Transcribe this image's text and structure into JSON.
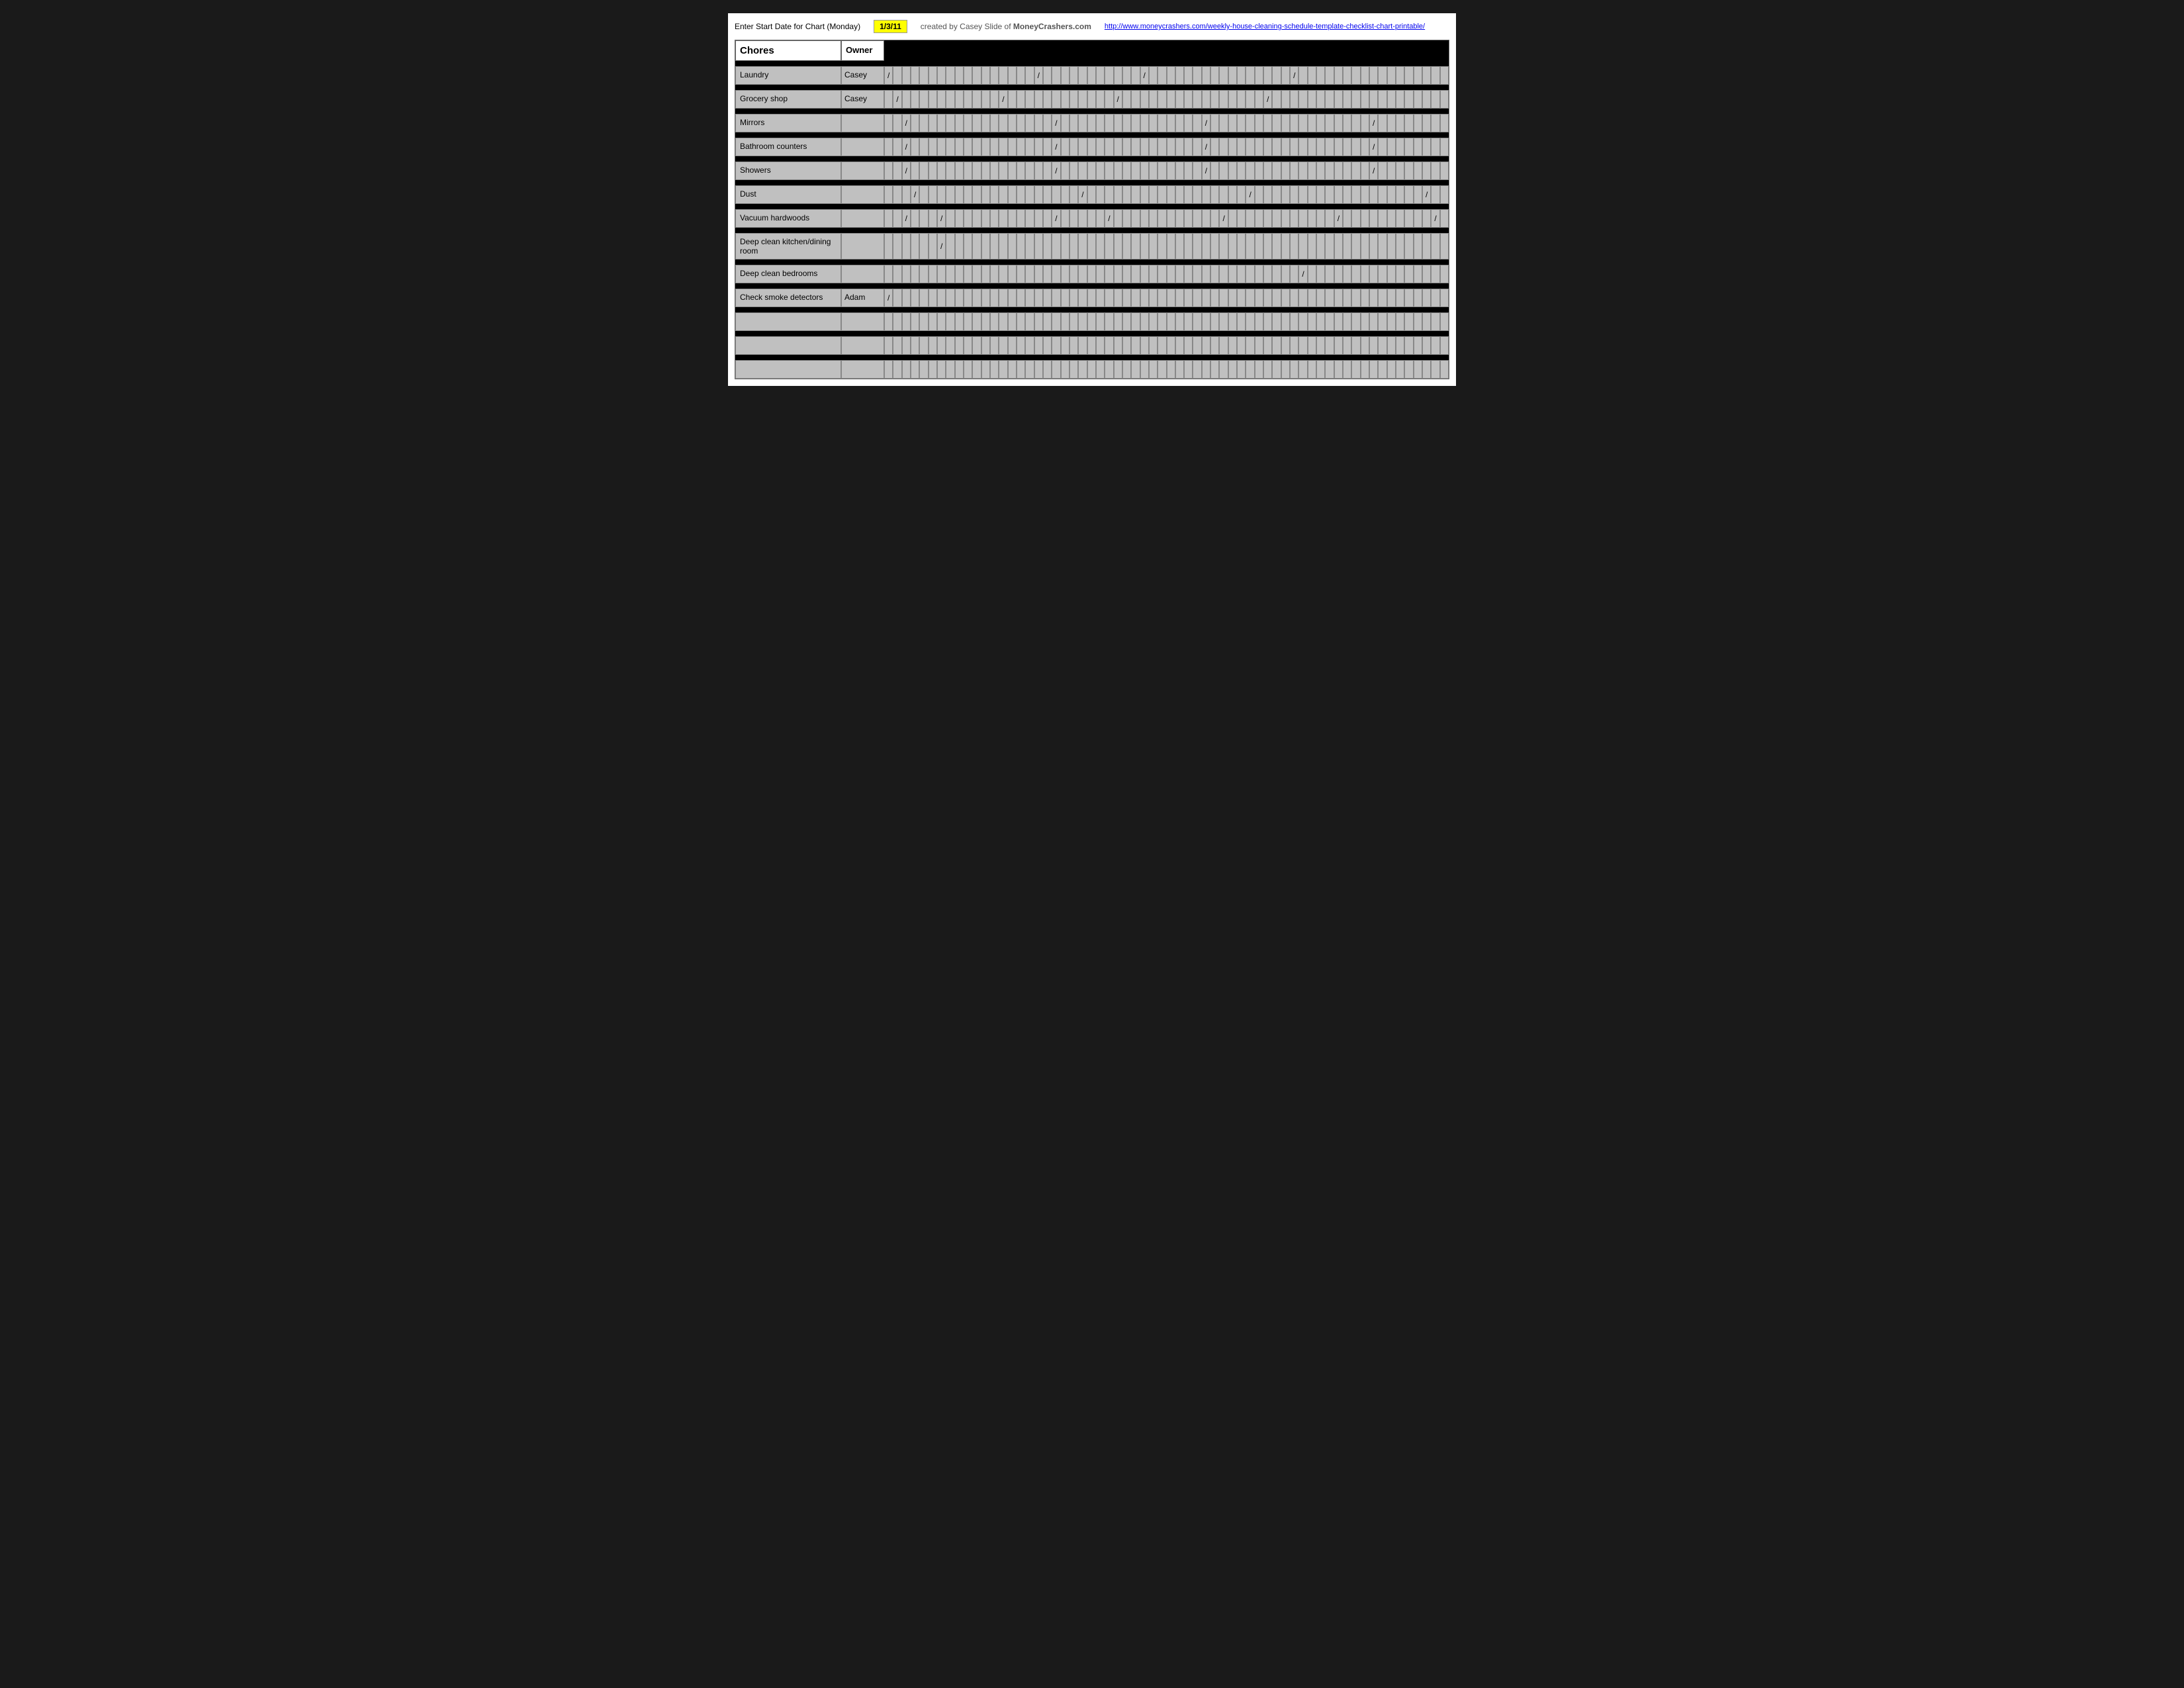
{
  "topbar": {
    "start_date_label": "Enter Start Date for Chart (Monday)",
    "start_date_value": "1/3/11",
    "created_by_prefix": "created by Casey Slide of ",
    "created_by_site": "MoneyCrashers.com",
    "link_url": "http://www.moneycrashers.com/weekly-house-cleaning-schedule-template-checklist-chart-printable/",
    "link_text": "http://www.moneycrashers.com/weekly-house-cleaning-schedule-template-checklist-chart-printable/"
  },
  "header": {
    "chores_label": "Chores",
    "owner_label": "Owner"
  },
  "rows": [
    {
      "chore": "Laundry",
      "owner": "Casey",
      "marks": [
        "/",
        "",
        "",
        "",
        "",
        "",
        "",
        "",
        "",
        "",
        "",
        "",
        "",
        "",
        "",
        "",
        "",
        "/",
        "",
        "",
        "",
        "",
        "",
        "",
        "",
        "",
        "",
        "",
        "",
        "/",
        "",
        "",
        "",
        "",
        "",
        "",
        "",
        "",
        "",
        "",
        "",
        "",
        "",
        "",
        "",
        "",
        "/",
        "",
        "",
        "",
        "",
        "",
        "",
        "",
        "",
        "",
        "",
        "",
        "",
        "",
        "",
        "",
        "",
        "",
        ""
      ]
    },
    {
      "chore": "Grocery shop",
      "owner": "Casey",
      "marks": [
        "",
        "/",
        "",
        "",
        "",
        "",
        "",
        "",
        "",
        "",
        "",
        "",
        "",
        "/",
        "",
        "",
        "",
        "",
        "",
        "",
        "",
        "",
        "",
        "",
        "",
        "",
        "/",
        "",
        "",
        "",
        "",
        "",
        "",
        "",
        "",
        "",
        "",
        "",
        "",
        "",
        "",
        "",
        "",
        "/",
        "",
        "",
        "",
        "",
        "",
        "",
        "",
        "",
        "",
        "",
        "",
        "",
        "",
        "",
        "",
        "",
        "",
        "",
        ""
      ]
    },
    {
      "chore": "Mirrors",
      "owner": "",
      "marks": [
        "",
        "",
        "/",
        "",
        "",
        "",
        "",
        "",
        "",
        "",
        "",
        "",
        "",
        "",
        "",
        "",
        "",
        "",
        "",
        "/",
        "",
        "",
        "",
        "",
        "",
        "",
        "",
        "",
        "",
        "",
        "",
        "",
        "",
        "",
        "",
        "",
        "/",
        "",
        "",
        "",
        "",
        "",
        "",
        "",
        "",
        "",
        "",
        "",
        "",
        "",
        "",
        "",
        "",
        "",
        "",
        "/",
        "",
        "",
        "",
        "",
        "",
        "",
        "",
        ""
      ]
    },
    {
      "chore": "Bathroom counters",
      "owner": "",
      "marks": [
        "",
        "",
        "/",
        "",
        "",
        "",
        "",
        "",
        "",
        "",
        "",
        "",
        "",
        "",
        "",
        "",
        "",
        "",
        "",
        "/",
        "",
        "",
        "",
        "",
        "",
        "",
        "",
        "",
        "",
        "",
        "",
        "",
        "",
        "",
        "",
        "",
        "/",
        "",
        "",
        "",
        "",
        "",
        "",
        "",
        "",
        "",
        "",
        "",
        "",
        "",
        "",
        "",
        "",
        "",
        "",
        "/",
        "",
        "",
        "",
        "",
        "",
        "",
        "",
        ""
      ]
    },
    {
      "chore": "Showers",
      "owner": "",
      "marks": [
        "",
        "",
        "/",
        "",
        "",
        "",
        "",
        "",
        "",
        "",
        "",
        "",
        "",
        "",
        "",
        "",
        "",
        "",
        "",
        "/",
        "",
        "",
        "",
        "",
        "",
        "",
        "",
        "",
        "",
        "",
        "",
        "",
        "",
        "",
        "",
        "",
        "/",
        "",
        "",
        "",
        "",
        "",
        "",
        "",
        "",
        "",
        "",
        "",
        "",
        "",
        "",
        "",
        "",
        "",
        "",
        "/",
        "",
        "",
        "",
        "",
        "",
        "",
        "",
        ""
      ]
    },
    {
      "chore": "Dust",
      "owner": "",
      "marks": [
        "",
        "",
        "",
        "/",
        "",
        "",
        "",
        "",
        "",
        "",
        "",
        "",
        "",
        "",
        "",
        "",
        "",
        "",
        "",
        "",
        "",
        "",
        "/",
        "",
        "",
        "",
        "",
        "",
        "",
        "",
        "",
        "",
        "",
        "",
        "",
        "",
        "",
        "",
        "",
        "",
        "",
        "/",
        "",
        "",
        "",
        "",
        "",
        "",
        "",
        "",
        "",
        "",
        "",
        "",
        "",
        "",
        "",
        "",
        "",
        "",
        "",
        "/",
        "",
        ""
      ]
    },
    {
      "chore": "Vacuum hardwoods",
      "owner": "",
      "marks": [
        "",
        "",
        "/",
        "",
        "",
        "",
        "/",
        "",
        "",
        "",
        "",
        "",
        "",
        "",
        "",
        "",
        "",
        "",
        "",
        "/",
        "",
        "",
        "",
        "",
        "",
        "/",
        "",
        "",
        "",
        "",
        "",
        "",
        "",
        "",
        "",
        "",
        "",
        "",
        "/",
        "",
        "",
        "",
        "",
        "",
        "",
        "",
        "",
        "",
        "",
        "",
        "",
        "/",
        "",
        "",
        "",
        "",
        "",
        "",
        "",
        "",
        "",
        "",
        "/"
      ]
    },
    {
      "chore": "Deep clean kitchen/dining room",
      "owner": "",
      "marks": [
        "",
        "",
        "",
        "",
        "",
        "",
        "/",
        "",
        "",
        "",
        "",
        "",
        "",
        "",
        "",
        "",
        "",
        "",
        "",
        "",
        "",
        "",
        "",
        "",
        "",
        "",
        "",
        "",
        "",
        "",
        "",
        "",
        "",
        "",
        "",
        "",
        "",
        "",
        "",
        "",
        "",
        "",
        "",
        "",
        "",
        "",
        "",
        "",
        "",
        "",
        "",
        "",
        "",
        "",
        "",
        "",
        "",
        "",
        "",
        "",
        "",
        "",
        "",
        ""
      ]
    },
    {
      "chore": "Deep clean bedrooms",
      "owner": "",
      "marks": [
        "",
        "",
        "",
        "",
        "",
        "",
        "",
        "",
        "",
        "",
        "",
        "",
        "",
        "",
        "",
        "",
        "",
        "",
        "",
        "",
        "",
        "",
        "",
        "",
        "",
        "",
        "",
        "",
        "",
        "",
        "",
        "",
        "",
        "",
        "",
        "",
        "",
        "",
        "",
        "",
        "",
        "",
        "",
        "",
        "",
        "",
        "",
        "/",
        "",
        "",
        "",
        "",
        "",
        "",
        "",
        "",
        "",
        "",
        "",
        "",
        "",
        "",
        "",
        "",
        ""
      ]
    },
    {
      "chore": "Check smoke detectors",
      "owner": "Adam",
      "marks": [
        "/",
        "",
        "",
        "",
        "",
        "",
        "",
        "",
        "",
        "",
        "",
        "",
        "",
        "",
        "",
        "",
        "",
        "",
        "",
        "",
        "",
        "",
        "",
        "",
        "",
        "",
        "",
        "",
        "",
        "",
        "",
        "",
        "",
        "",
        "",
        "",
        "",
        "",
        "",
        "",
        "",
        "",
        "",
        "",
        "",
        "",
        "",
        "",
        "",
        "",
        "",
        "",
        "",
        "",
        "",
        "",
        "",
        "",
        "",
        "",
        "",
        "",
        "",
        ""
      ]
    },
    {
      "chore": "",
      "owner": "",
      "marks": [
        "",
        "",
        "",
        "",
        "",
        "",
        "",
        "",
        "",
        "",
        "",
        "",
        "",
        "",
        "",
        "",
        "",
        "",
        "",
        "",
        "",
        "",
        "",
        "",
        "",
        "",
        "",
        "",
        "",
        "",
        "",
        "",
        "",
        "",
        "",
        "",
        "",
        "",
        "",
        "",
        "",
        "",
        "",
        "",
        "",
        "",
        "",
        "",
        "",
        "",
        "",
        "",
        "",
        "",
        "",
        "",
        "",
        "",
        "",
        "",
        "",
        "",
        "",
        ""
      ]
    },
    {
      "chore": "",
      "owner": "",
      "marks": [
        "",
        "",
        "",
        "",
        "",
        "",
        "",
        "",
        "",
        "",
        "",
        "",
        "",
        "",
        "",
        "",
        "",
        "",
        "",
        "",
        "",
        "",
        "",
        "",
        "",
        "",
        "",
        "",
        "",
        "",
        "",
        "",
        "",
        "",
        "",
        "",
        "",
        "",
        "",
        "",
        "",
        "",
        "",
        "",
        "",
        "",
        "",
        "",
        "",
        "",
        "",
        "",
        "",
        "",
        "",
        "",
        "",
        "",
        "",
        "",
        "",
        "",
        "",
        ""
      ]
    },
    {
      "chore": "",
      "owner": "",
      "marks": [
        "",
        "",
        "",
        "",
        "",
        "",
        "",
        "",
        "",
        "",
        "",
        "",
        "",
        "",
        "",
        "",
        "",
        "",
        "",
        "",
        "",
        "",
        "",
        "",
        "",
        "",
        "",
        "",
        "",
        "",
        "",
        "",
        "",
        "",
        "",
        "",
        "",
        "",
        "",
        "",
        "",
        "",
        "",
        "",
        "",
        "",
        "",
        "",
        "",
        "",
        "",
        "",
        "",
        "",
        "",
        "",
        "",
        "",
        "",
        "",
        "",
        "",
        "",
        ""
      ]
    }
  ],
  "num_day_cells": 64
}
